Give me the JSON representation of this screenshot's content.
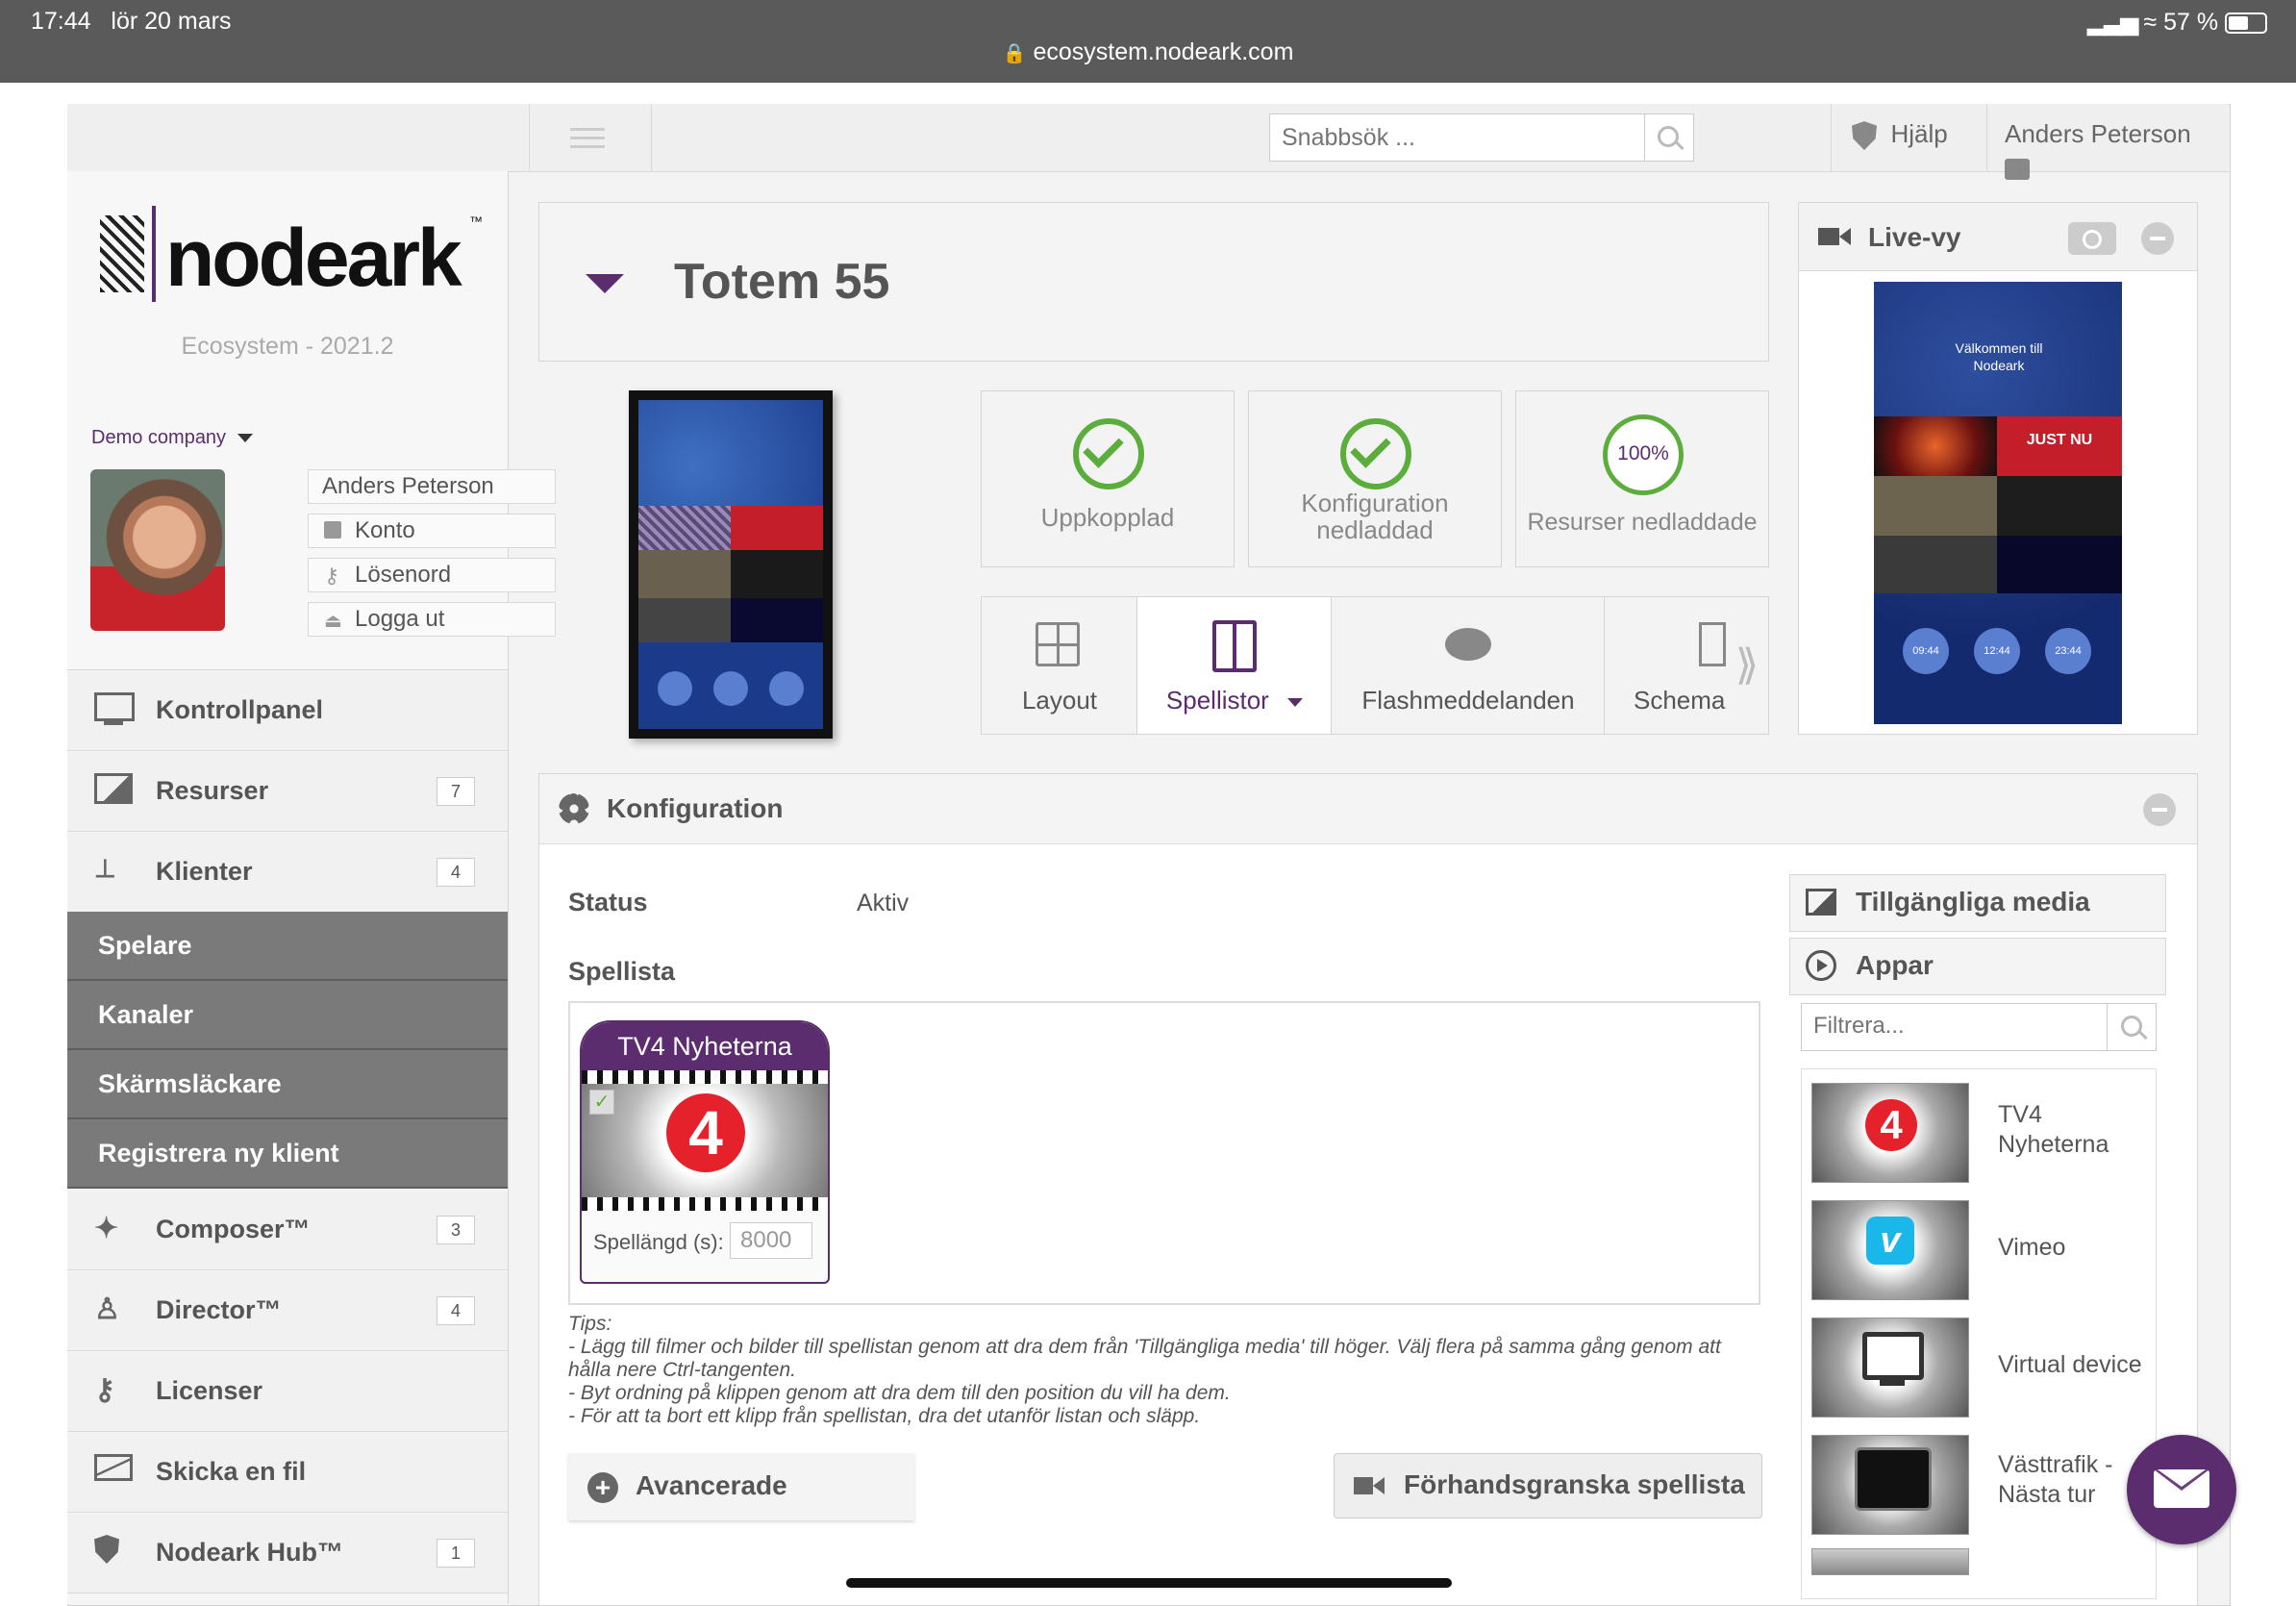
{
  "status_bar": {
    "time": "17:44",
    "date": "lör 20 mars",
    "url": "ecosystem.nodeark.com",
    "battery": "57 %"
  },
  "topbar": {
    "search_placeholder": "Snabbsök ...",
    "help": "Hjälp",
    "user": "Anders Peterson"
  },
  "brand": {
    "logo": "nodeark",
    "tm": "™",
    "version": "Ecosystem - 2021.2"
  },
  "account": {
    "company": "Demo company",
    "name": "Anders Peterson",
    "konto": "Konto",
    "losenord": "Lösenord",
    "logout": "Logga ut"
  },
  "nav": [
    {
      "label": "Kontrollpanel",
      "count": ""
    },
    {
      "label": "Resurser",
      "count": "7"
    },
    {
      "label": "Klienter",
      "count": "4"
    },
    {
      "label": "Composer™",
      "count": "3"
    },
    {
      "label": "Director™",
      "count": "4"
    },
    {
      "label": "Licenser",
      "count": ""
    },
    {
      "label": "Skicka en fil",
      "count": ""
    },
    {
      "label": "Nodeark Hub™",
      "count": "1"
    }
  ],
  "subnav": [
    "Spelare",
    "Kanaler",
    "Skärmsläckare",
    "Registrera ny klient"
  ],
  "device": {
    "title": "Totem 55"
  },
  "status_tiles": {
    "connected": "Uppkopplad",
    "config": "Konfiguration nedladdad",
    "resources_pct": "100%",
    "resources": "Resurser nedladdade"
  },
  "tabs": {
    "layout": "Layout",
    "playlists": "Spellistor",
    "flash": "Flashmeddelanden",
    "schedule": "Schema"
  },
  "live": {
    "title": "Live-vy",
    "welcome": "Välkommen till Nodeark",
    "just_nu": "JUST NU",
    "clock1": "09:44",
    "clock2": "12:44",
    "clock3": "23:44"
  },
  "config": {
    "title": "Konfiguration",
    "status_label": "Status",
    "status_value": "Aktiv",
    "playlist_label": "Spellista",
    "clip_title": "TV4 Nyheterna",
    "clip_duration_label": "Spellängd (s):",
    "clip_duration": "8000",
    "tips": [
      "Tips:",
      "- Lägg till filmer och bilder till spellistan genom att dra dem från 'Tillgängliga media' till höger. Välj flera på samma gång genom att hålla nere Ctrl-tangenten.",
      "- Byt ordning på klippen genom att dra dem till den position du vill ha dem.",
      "- För att ta bort ett klipp från spellistan, dra det utanför listan och släpp."
    ],
    "advanced": "Avancerade",
    "preview": "Förhandsgranska spellista"
  },
  "media": {
    "available": "Tillgängliga media",
    "apps": "Appar",
    "filter_placeholder": "Filtrera...",
    "items": [
      "TV4 Nyheterna",
      "Vimeo",
      "Virtual device",
      "Västtrafik - Nästa tur"
    ]
  },
  "colors": {
    "accent": "#5b2d6e",
    "check": "#5cae3c",
    "sidebar_active": "#7a7a7a"
  }
}
